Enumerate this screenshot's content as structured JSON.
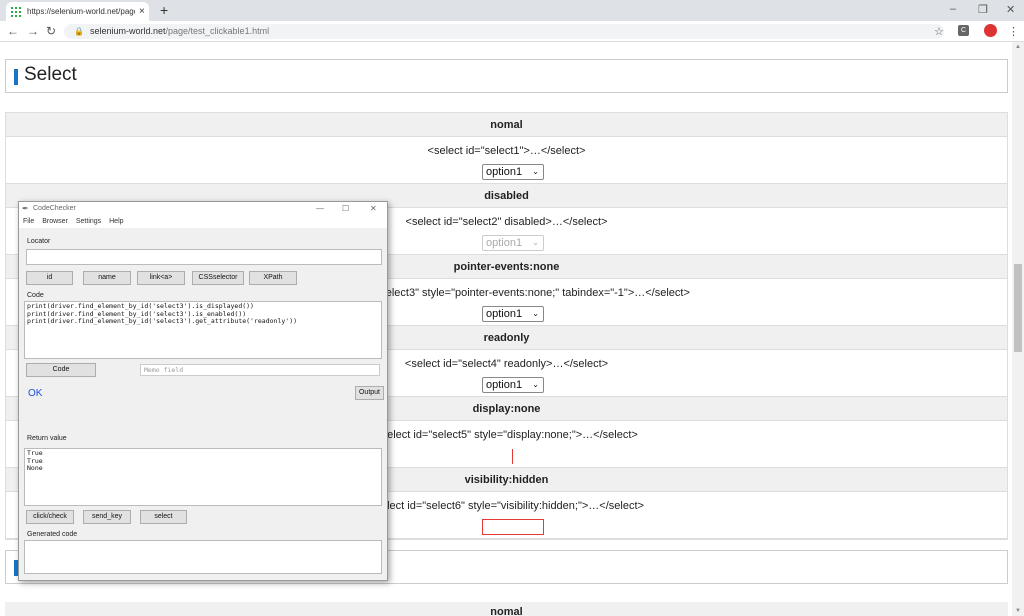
{
  "browser": {
    "tab_title": "https://selenium-world.net/page/",
    "tab_close": "×",
    "new_tab": "+",
    "url_host": "selenium-world.net",
    "url_path": "/page/test_clickable1.html",
    "window_controls": [
      "–",
      "❐",
      "✕"
    ],
    "nav": {
      "back": "←",
      "forward": "→",
      "reload": "↻"
    },
    "toolbar_icons": [
      "star-icon",
      "extension-icon",
      "profile-icon",
      "kebab-menu-icon"
    ]
  },
  "page": {
    "section_title": "Select",
    "rows": [
      {
        "header": "nomal",
        "code": "<select id=\"select1\">…</select>",
        "control": "option1",
        "state": "normal"
      },
      {
        "header": "disabled",
        "code": "<select id=\"select2\" disabled>…</select>",
        "control": "option1",
        "state": "disabled"
      },
      {
        "header": "pointer-events:none",
        "code": "<select id=\"select3\" style=\"pointer-events:none;\" tabindex=\"-1\">…</select>",
        "control": "option1",
        "state": "normal"
      },
      {
        "header": "readonly",
        "code": "<select id=\"select4\" readonly>…</select>",
        "control": "option1",
        "state": "normal"
      },
      {
        "header": "display:none",
        "code": "<select id=\"select5\" style=\"display:none;\">…</select>",
        "control": "",
        "state": "hidden-line"
      },
      {
        "header": "visibility:hidden",
        "code": "<select id=\"select6\" style=\"visibility:hidden;\">…</select>",
        "control": "",
        "state": "hidden-box"
      }
    ],
    "next_header": "nomal"
  },
  "code_checker": {
    "title": "CodeChecker",
    "menu": [
      "File",
      "Browser",
      "Settings",
      "Help"
    ],
    "locator_label": "Locator",
    "locator_value": "",
    "locator_buttons": [
      "id",
      "name",
      "link<a>",
      "CSSselector",
      "XPath"
    ],
    "code_label": "Code",
    "code_text": "print(driver.find_element_by_id('select3').is_displayed())\nprint(driver.find_element_by_id('select3').is_enabled())\nprint(driver.find_element_by_id('select3').get_attribute('readonly'))",
    "code_button": "Code",
    "memo_placeholder": "Memo field",
    "status": "OK",
    "output_button": "Output",
    "return_label": "Return value",
    "return_text": "True\nTrue\nNone",
    "action_buttons": [
      "click/check",
      "send_key",
      "select"
    ],
    "generated_label": "Generated code",
    "generated_text": ""
  }
}
